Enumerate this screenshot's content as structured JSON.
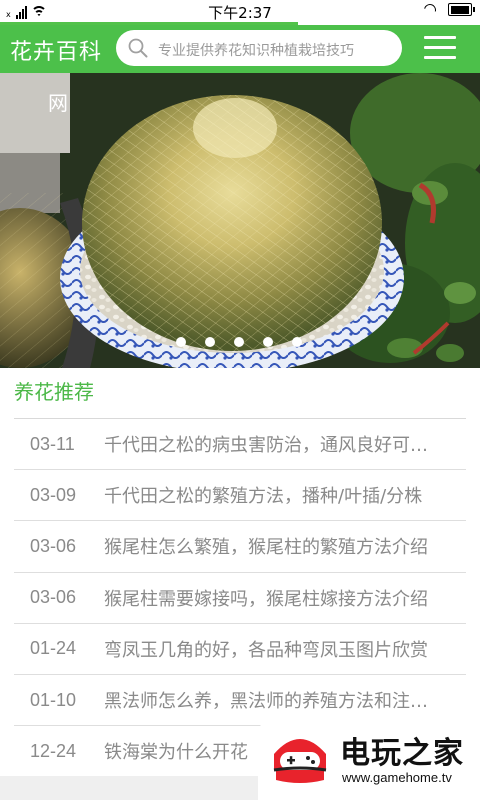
{
  "status_bar": {
    "time": "下午2:37",
    "signal_label": "x",
    "battery_level": 0.95
  },
  "page_load_progress": 0.62,
  "header": {
    "title": "花卉百科",
    "search_placeholder": "专业提供养花知识种植栽培技巧",
    "menu_icon": "menu-icon"
  },
  "banner": {
    "caption": "网",
    "slide_count": 5,
    "active_slide": 1
  },
  "section": {
    "title": "养花推荐"
  },
  "articles": [
    {
      "date": "03-11",
      "title": "千代田之松的病虫害防治，通风良好可预防"
    },
    {
      "date": "03-09",
      "title": "千代田之松的繁殖方法，播种/叶插/分株"
    },
    {
      "date": "03-06",
      "title": "猴尾柱怎么繁殖，猴尾柱的繁殖方法介绍"
    },
    {
      "date": "03-06",
      "title": "猴尾柱需要嫁接吗，猴尾柱嫁接方法介绍"
    },
    {
      "date": "01-24",
      "title": "弯凤玉几角的好，各品种弯凤玉图片欣赏"
    },
    {
      "date": "01-10",
      "title": "黑法师怎么养，黑法师的养殖方法和注意事项"
    },
    {
      "date": "12-24",
      "title": "铁海棠为什么开花"
    }
  ],
  "watermark": {
    "title": "电玩之家",
    "url": "www.gamehome.tv"
  },
  "colors": {
    "brand_green": "#4cc04a",
    "section_green": "#4cb848",
    "text_gray": "#8a8a8a"
  }
}
